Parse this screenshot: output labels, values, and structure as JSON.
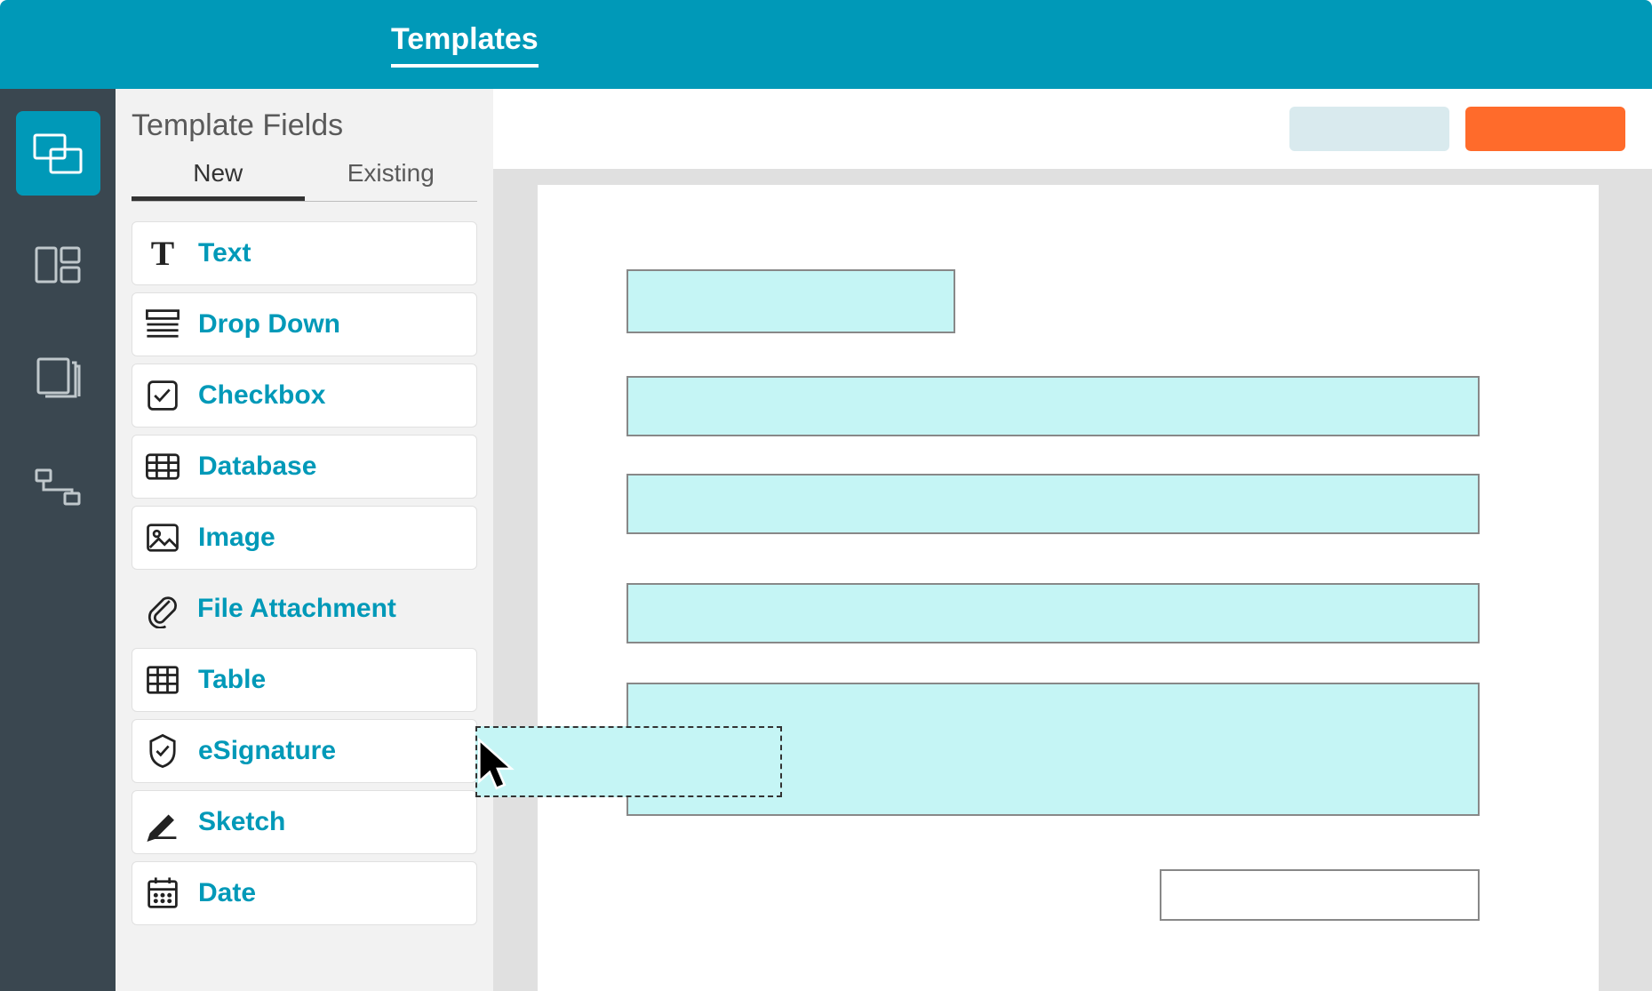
{
  "header": {
    "title": "Templates"
  },
  "rail": {
    "items": [
      {
        "name": "templates-icon",
        "active": true
      },
      {
        "name": "layout-icon",
        "active": false
      },
      {
        "name": "pages-icon",
        "active": false
      },
      {
        "name": "workflow-icon",
        "active": false
      }
    ]
  },
  "sidebar": {
    "title": "Template Fields",
    "tabs": [
      {
        "label": "New",
        "active": true
      },
      {
        "label": "Existing",
        "active": false
      }
    ],
    "fields": [
      {
        "icon": "text-icon",
        "label": "Text"
      },
      {
        "icon": "dropdown-icon",
        "label": "Drop Down"
      },
      {
        "icon": "checkbox-icon",
        "label": "Checkbox"
      },
      {
        "icon": "database-icon",
        "label": "Database"
      },
      {
        "icon": "image-icon",
        "label": "Image"
      },
      {
        "icon": "attachment-icon",
        "label": "File Attachment",
        "dragging": true
      },
      {
        "icon": "table-icon",
        "label": "Table"
      },
      {
        "icon": "esignature-icon",
        "label": "eSignature"
      },
      {
        "icon": "sketch-icon",
        "label": "Sketch"
      },
      {
        "icon": "date-icon",
        "label": "Date"
      }
    ]
  },
  "toolbar": {
    "secondary_label": "",
    "primary_label": ""
  },
  "colors": {
    "accent": "#0099b8",
    "primary_btn": "#ff6b2b",
    "placeholder_fill": "#c5f5f5"
  }
}
